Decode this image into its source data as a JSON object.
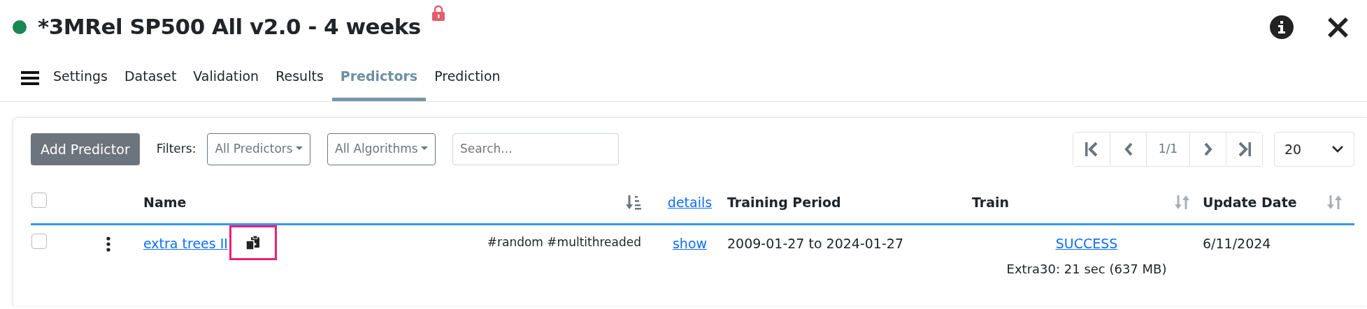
{
  "header": {
    "online": true,
    "title": "*3MRel SP500 All v2.0 - 4 weeks",
    "locked": true
  },
  "tabs": [
    {
      "label": "Settings",
      "selected": false
    },
    {
      "label": "Dataset",
      "selected": false
    },
    {
      "label": "Validation",
      "selected": false
    },
    {
      "label": "Results",
      "selected": false
    },
    {
      "label": "Predictors",
      "selected": true
    },
    {
      "label": "Prediction",
      "selected": false
    }
  ],
  "toolbar": {
    "add_button": "Add Predictor",
    "filters_label": "Filters:",
    "filters": [
      "All Predictors",
      "All Algorithms"
    ],
    "search": {
      "placeholder": "Search..."
    },
    "pager": {
      "page": "1/1"
    },
    "page_size": "20"
  },
  "table": {
    "select_all_checked": false,
    "columns": [
      {
        "label": "Name",
        "kind": "sorted"
      },
      {
        "label": "details",
        "kind": "link"
      },
      {
        "label": "Training Period",
        "kind": "plain"
      },
      {
        "label": "Train",
        "kind": "sortable"
      },
      {
        "label": "Update Date",
        "kind": "sortable"
      }
    ],
    "rows": [
      {
        "checked": false,
        "name": "extra trees II",
        "copy_highlighted": true,
        "tags": "#random #multithreaded",
        "details": "show",
        "training_period": "2009-01-27 to 2024-01-27",
        "train_status": "SUCCESS",
        "train_info": "Extra30: 21 sec (637 MB)",
        "update_date": "6/11/2024"
      }
    ]
  }
}
